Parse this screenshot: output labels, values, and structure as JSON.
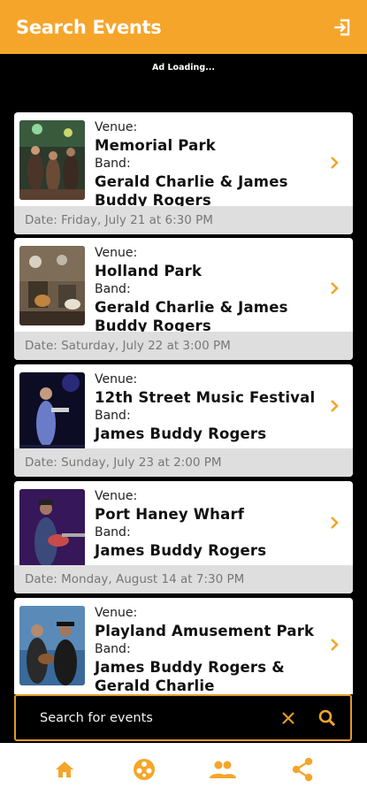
{
  "header": {
    "title": "Search Events"
  },
  "ad": {
    "text": "Ad Loading..."
  },
  "labels": {
    "venue": "Venue:",
    "band": "Band:"
  },
  "events": [
    {
      "venue": "Memorial Park",
      "band": "Gerald Charlie & James Buddy Rogers",
      "date": "Date: Friday, July 21 at 6:30 PM"
    },
    {
      "venue": "Holland Park",
      "band": "Gerald Charlie & James Buddy Rogers",
      "date": "Date: Saturday, July 22 at 3:00 PM"
    },
    {
      "venue": "12th Street Music Festival",
      "band": "James Buddy Rogers",
      "date": "Date: Sunday, July 23 at 2:00 PM"
    },
    {
      "venue": "Port Haney Wharf",
      "band": "James Buddy Rogers",
      "date": "Date: Monday, August 14 at 7:30 PM"
    },
    {
      "venue": "Playland Amusement Park",
      "band": "James Buddy Rogers & Gerald Charlie",
      "date": ""
    }
  ],
  "search": {
    "placeholder": "Search for events",
    "value": ""
  },
  "colors": {
    "accent": "#f5a52a",
    "date_bar": "#dedede",
    "background": "#000000"
  },
  "icons": {
    "header": "logout-icon",
    "card": "chevron-right-icon",
    "search": [
      "clear-icon",
      "search-icon"
    ],
    "nav": [
      "home-icon",
      "film-reel-icon",
      "group-icon",
      "share-icon"
    ]
  }
}
